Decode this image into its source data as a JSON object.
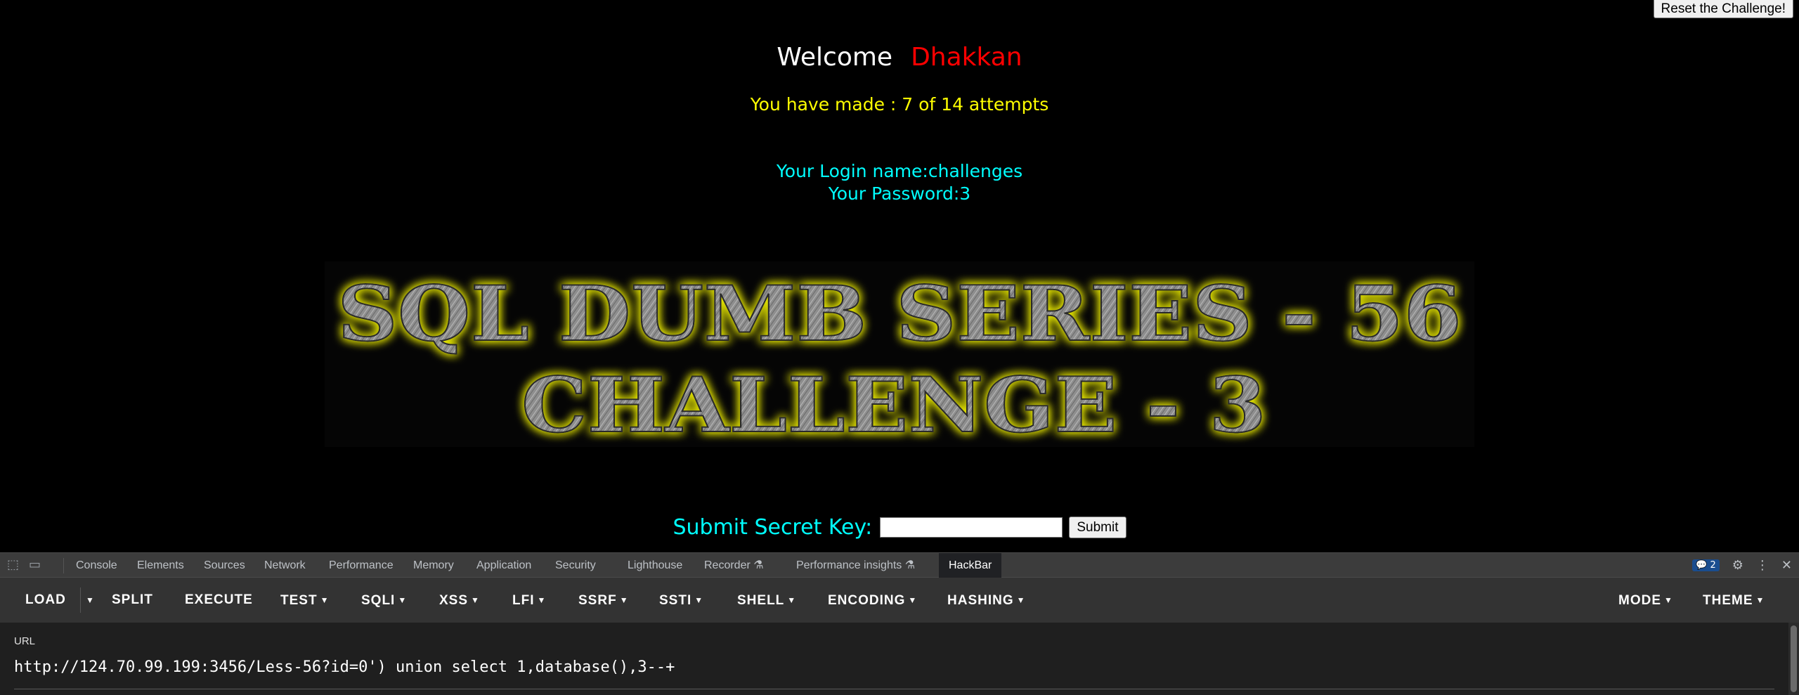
{
  "page": {
    "reset_label": "Reset the Challenge!",
    "welcome": "Welcome",
    "username": "Dhakkan",
    "attempts": "You have made : 7 of 14 attempts",
    "login_line": "Your Login name:challenges",
    "password_line": "Your Password:3",
    "banner_line1": "SQL DUMB SERIES - 56",
    "banner_line2": "CHALLENGE - 3",
    "secret_label": "Submit Secret Key:",
    "secret_value": "",
    "submit_label": "Submit"
  },
  "devtools": {
    "tabs": [
      "Console",
      "Elements",
      "Sources",
      "Network",
      "Performance",
      "Memory",
      "Application",
      "Security",
      "Lighthouse",
      "Recorder",
      "Performance insights",
      "HackBar"
    ],
    "active_tab": "HackBar",
    "issues_count": "2",
    "icons": [
      "inspect-icon",
      "device-toggle-icon",
      "flask-icon",
      "gear-icon",
      "more-icon",
      "close-icon"
    ]
  },
  "hackbar": {
    "buttons": [
      "LOAD",
      "SPLIT",
      "EXECUTE",
      "TEST",
      "SQLI",
      "XSS",
      "LFI",
      "SSRF",
      "SSTI",
      "SHELL",
      "ENCODING",
      "HASHING",
      "MODE",
      "THEME"
    ],
    "url_label": "URL",
    "url_value": "http://124.70.99.199:3456/Less-56?id=0') union select 1,database(),3--+"
  },
  "colors": {
    "welcome": "#ffffff",
    "username": "#ff0000",
    "attempts": "#ffff00",
    "login": "#00ffff",
    "banner_glow": "#e8e800"
  }
}
